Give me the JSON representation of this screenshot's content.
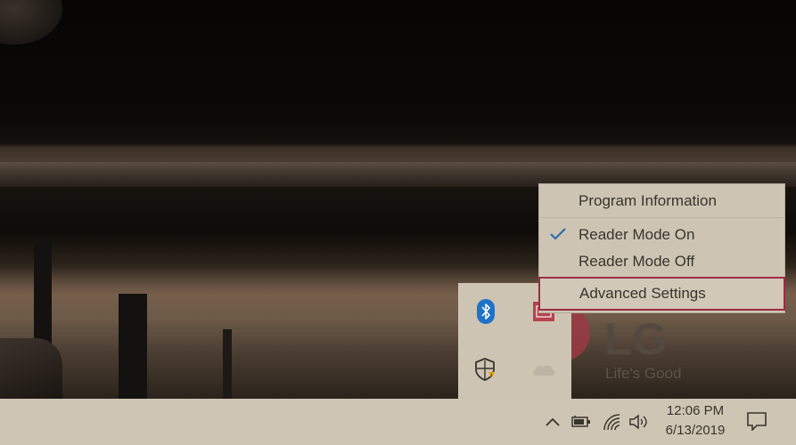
{
  "wallpaper": {
    "logo_text": "LG",
    "tagline": "Life's Good"
  },
  "context_menu": {
    "items": [
      {
        "label": "Program Information",
        "checked": false
      },
      {
        "label": "Reader Mode On",
        "checked": true
      },
      {
        "label": "Reader Mode Off",
        "checked": false
      },
      {
        "label": "Advanced Settings",
        "checked": false,
        "highlighted": true
      }
    ]
  },
  "tray_popup": {
    "icons": [
      "bluetooth-icon",
      "app-tray-icon",
      "windows-security-icon",
      "onedrive-icon"
    ]
  },
  "taskbar": {
    "icons": [
      "chevron-up-icon",
      "battery-icon",
      "wifi-icon",
      "volume-icon",
      "action-center-icon"
    ],
    "time": "12:06 PM",
    "date": "6/13/2019"
  },
  "colors": {
    "highlight_border": "#a02a45",
    "bluetooth_blue": "#1e73c8",
    "check_blue": "#2b6fb5",
    "lg_red": "#9b3a44"
  }
}
